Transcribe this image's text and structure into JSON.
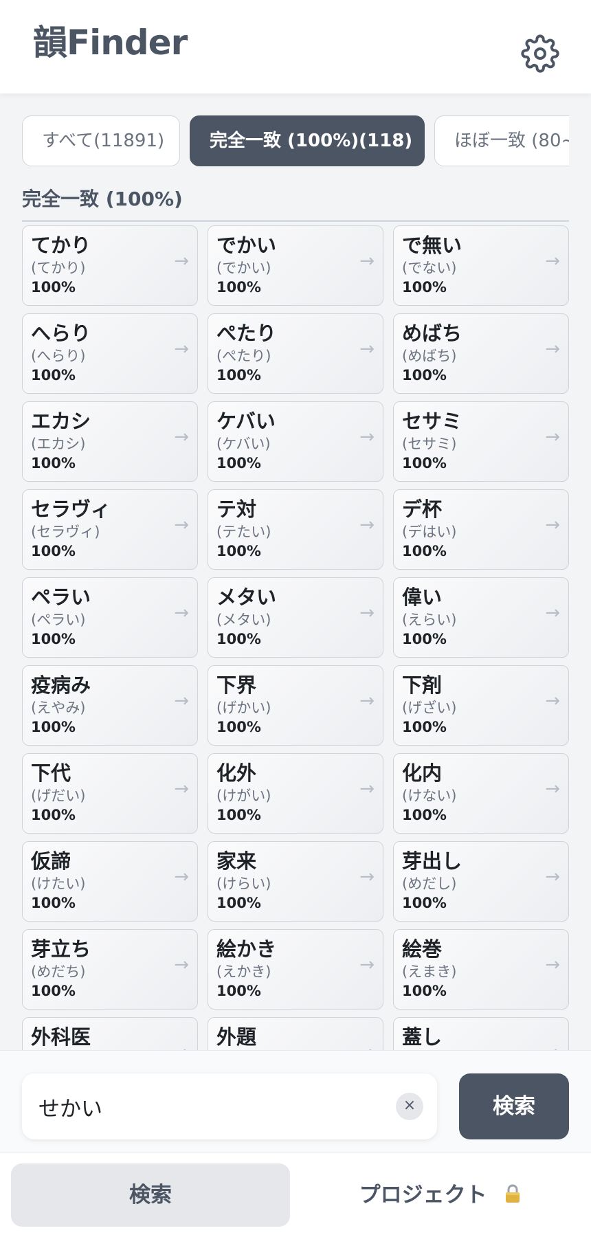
{
  "app": {
    "title": "韻Finder"
  },
  "header": {
    "settings_icon": "gear-icon"
  },
  "tabs": [
    {
      "label": "すべて(11891)",
      "active": false
    },
    {
      "label": "完全一致 (100%)(118)",
      "active": true
    },
    {
      "label": "ほぼ一致 (80~",
      "active": false
    }
  ],
  "section": {
    "title": "完全一致 (100%)"
  },
  "results": [
    {
      "word": "てかり",
      "reading": "(てかり)",
      "score": "100%"
    },
    {
      "word": "でかい",
      "reading": "(でかい)",
      "score": "100%"
    },
    {
      "word": "で無い",
      "reading": "(でない)",
      "score": "100%"
    },
    {
      "word": "へらり",
      "reading": "(へらり)",
      "score": "100%"
    },
    {
      "word": "ぺたり",
      "reading": "(ぺたり)",
      "score": "100%"
    },
    {
      "word": "めばち",
      "reading": "(めばち)",
      "score": "100%"
    },
    {
      "word": "エカシ",
      "reading": "(エカシ)",
      "score": "100%"
    },
    {
      "word": "ケバい",
      "reading": "(ケバい)",
      "score": "100%"
    },
    {
      "word": "セサミ",
      "reading": "(セサミ)",
      "score": "100%"
    },
    {
      "word": "セラヴィ",
      "reading": "(セラヴィ)",
      "score": "100%"
    },
    {
      "word": "テ対",
      "reading": "(テたい)",
      "score": "100%"
    },
    {
      "word": "デ杯",
      "reading": "(デはい)",
      "score": "100%"
    },
    {
      "word": "ペラい",
      "reading": "(ペラい)",
      "score": "100%"
    },
    {
      "word": "メタい",
      "reading": "(メタい)",
      "score": "100%"
    },
    {
      "word": "偉い",
      "reading": "(えらい)",
      "score": "100%"
    },
    {
      "word": "疫病み",
      "reading": "(えやみ)",
      "score": "100%"
    },
    {
      "word": "下界",
      "reading": "(げかい)",
      "score": "100%"
    },
    {
      "word": "下剤",
      "reading": "(げざい)",
      "score": "100%"
    },
    {
      "word": "下代",
      "reading": "(げだい)",
      "score": "100%"
    },
    {
      "word": "化外",
      "reading": "(けがい)",
      "score": "100%"
    },
    {
      "word": "化内",
      "reading": "(けない)",
      "score": "100%"
    },
    {
      "word": "仮諦",
      "reading": "(けたい)",
      "score": "100%"
    },
    {
      "word": "家来",
      "reading": "(けらい)",
      "score": "100%"
    },
    {
      "word": "芽出し",
      "reading": "(めだし)",
      "score": "100%"
    },
    {
      "word": "芽立ち",
      "reading": "(めだち)",
      "score": "100%"
    },
    {
      "word": "絵かき",
      "reading": "(えかき)",
      "score": "100%"
    },
    {
      "word": "絵巻",
      "reading": "(えまき)",
      "score": "100%"
    },
    {
      "word": "外科医",
      "reading": "",
      "score": ""
    },
    {
      "word": "外題",
      "reading": "",
      "score": ""
    },
    {
      "word": "蓋し",
      "reading": "",
      "score": ""
    }
  ],
  "search": {
    "value": "せかい",
    "clear_label": "×",
    "button_label": "検索"
  },
  "bottom_nav": {
    "search_label": "検索",
    "project_label": "プロジェクト"
  },
  "colors": {
    "accent": "#4b5563",
    "background": "#f3f4f6"
  }
}
